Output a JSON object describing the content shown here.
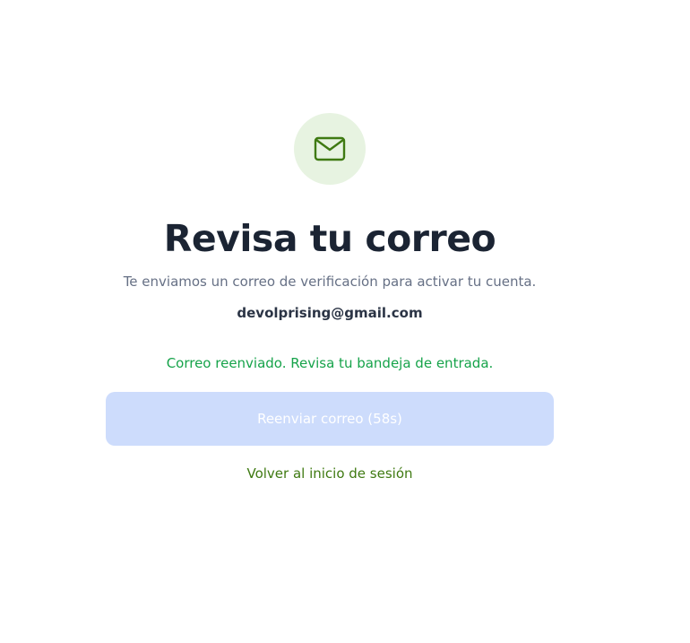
{
  "header": {
    "icon": "mail-icon",
    "title": "Revisa tu correo",
    "subtitle": "Te enviamos un correo de verificación para activar tu cuenta.",
    "email": "devolprising@gmail.com"
  },
  "status": {
    "message": "Correo reenviado. Revisa tu bandeja de entrada."
  },
  "actions": {
    "resend_label": "Reenviar correo (58s)",
    "back_label": "Volver al inicio de sesión"
  },
  "colors": {
    "icon_bg": "#e7f3e1",
    "icon_stroke": "#3f7a12",
    "title": "#1b2433",
    "success": "#16a34a",
    "button_disabled_bg": "#cddcfc",
    "link": "#3f7a12"
  }
}
